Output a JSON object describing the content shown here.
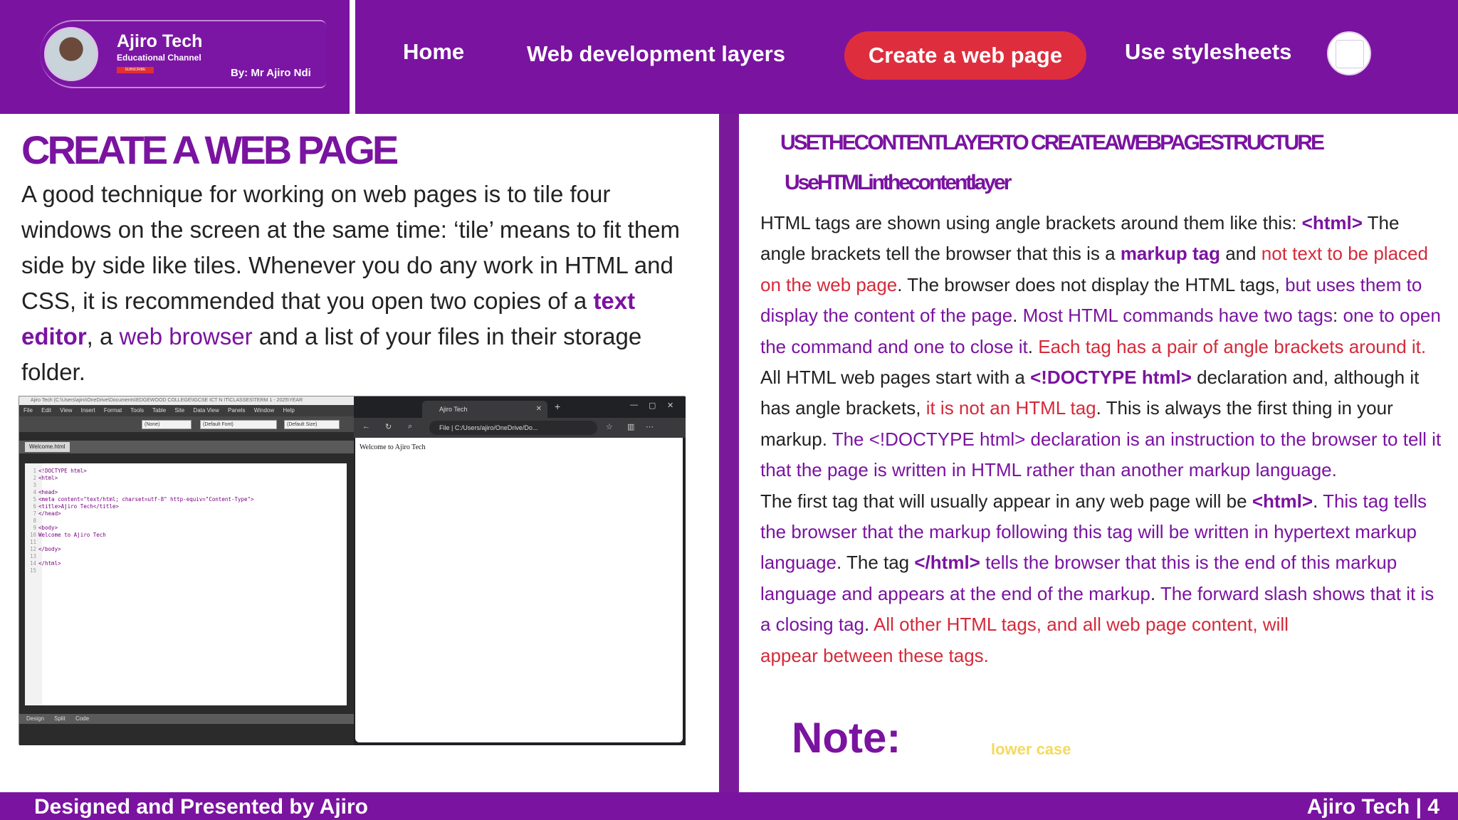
{
  "logo": {
    "title": "Ajiro Tech",
    "subtitle": "Educational Channel",
    "subscribe": "SUBSCRIBE",
    "by": "By: Mr Ajiro Ndi"
  },
  "nav": {
    "home": "Home",
    "layers": "Web development layers",
    "create": "Create a web page",
    "stylesheets": "Use stylesheets"
  },
  "left": {
    "title": "CREATE   A WEB  PAGE",
    "p1": "A good technique for working on web pages is to tile four windows on the screen at the same time: ‘tile’ means to fit them side by side like tiles. Whenever you do any work in HTML and CSS, it is recommended that you open two copies of a ",
    "kw1": "text editor",
    "p2": ", a ",
    "kw2": "web browser",
    "p3": " and a list of your files in their storage folder."
  },
  "editor": {
    "title_bar": "Ajiro Tech (C:\\Users\\ajiro\\OneDrive\\Documents\\EDGEWOOD COLLEGE\\IGCSE ICT N IT\\CLASSES\\TERM 1 - 2025\\YEAR",
    "menu": [
      "File",
      "Edit",
      "View",
      "Insert",
      "Format",
      "Tools",
      "Table",
      "Site",
      "Data View",
      "Panels",
      "Window",
      "Help"
    ],
    "style_dd": "(None)",
    "font_dd": "(Default Font)",
    "size_dd": "(Default Size)",
    "tab": "Welcome.html",
    "code": [
      {
        "n": "1",
        "t": "<!DOCTYPE html>"
      },
      {
        "n": "2",
        "t": "<html>"
      },
      {
        "n": "3",
        "t": ""
      },
      {
        "n": "4",
        "t": "<head>"
      },
      {
        "n": "5",
        "t": "<meta content=\"text/html; charset=utf-8\" http-equiv=\"Content-Type\">"
      },
      {
        "n": "6",
        "t": "<title>Ajiro Tech</title>"
      },
      {
        "n": "7",
        "t": "</head>"
      },
      {
        "n": "8",
        "t": ""
      },
      {
        "n": "9",
        "t": "<body>"
      },
      {
        "n": "10",
        "t": "Welcome to Ajiro Tech"
      },
      {
        "n": "11",
        "t": ""
      },
      {
        "n": "12",
        "t": "</body>"
      },
      {
        "n": "13",
        "t": ""
      },
      {
        "n": "14",
        "t": "</html>"
      },
      {
        "n": "15",
        "t": ""
      }
    ],
    "views": [
      "Design",
      "Split",
      "Code"
    ]
  },
  "browser": {
    "tab_title": "Ajiro Tech",
    "url_prefix": "File",
    "url": "C:/Users/ajiro/OneDrive/Do...",
    "page_text": "Welcome to Ajiro Tech"
  },
  "right": {
    "h1": "USETHECONTENTLAYERTO CREATEAWEBPAGESTRUCTURE",
    "h2": "UseHTMLinthecontentlayer",
    "note": "Note:",
    "lower": "lower case"
  },
  "footer": {
    "left": "Designed and Presented by Ajiro",
    "right": "Ajiro Tech | 4"
  },
  "colors": {
    "brand_purple": "#7a13a0",
    "accent_red": "#de2e3e",
    "note_yellow": "#f4d95e"
  }
}
